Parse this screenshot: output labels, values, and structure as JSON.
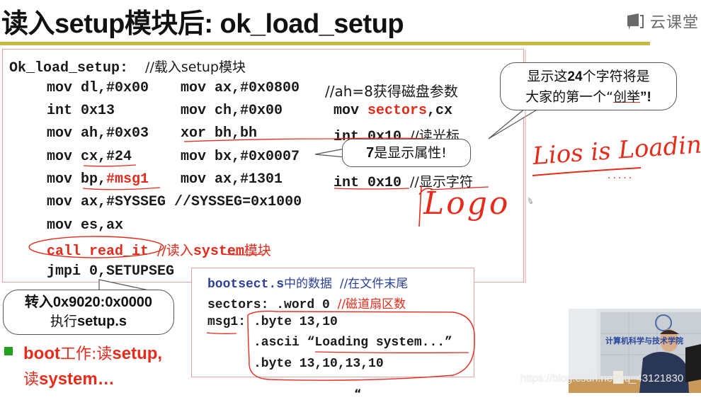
{
  "slide": {
    "title": "读入setup模块后: ok_load_setup",
    "logo_text": "云课堂",
    "logo_icon": "book-chat-icon"
  },
  "code": {
    "label_line": {
      "label": "Ok_load_setup:",
      "comment": "//载入setup模块"
    },
    "rows": [
      {
        "c1": "mov dl,#0x00",
        "c2": "mov ax,#0x0800",
        "c3_comment": "//ah=8获得磁盘参数"
      },
      {
        "c1": "int 0x13",
        "c2": "mov ch,#0x00",
        "c3_prefix": "mov ",
        "c3_red": "sectors",
        "c3_suffix": ",cx"
      },
      {
        "c1": "mov ah,#0x03",
        "c2": "xor bh,bh",
        "c3": "int 0x10",
        "c3_comment": "//读光标"
      },
      {
        "c1": "mov cx,#24",
        "c2": "mov bx,#0x0007"
      },
      {
        "c1_prefix": "mov bp,",
        "c1_red": "#msg1",
        "c2": "mov ax,#1301",
        "c3": "int 0x10",
        "c3_comment": "//显示字符"
      },
      {
        "c1": "mov ax,#SYSSEG",
        "c1_comment": "//SYSSEG=0x1000"
      },
      {
        "c1": "mov es,ax"
      },
      {
        "c1_red": "call read_it",
        "c1_comment_prefix": "//读入",
        "c1_comment_em": "system",
        "c1_comment_suffix": "模块"
      },
      {
        "c1": "jmpi 0,SETUPSEG"
      }
    ]
  },
  "callouts": {
    "chars": {
      "line1_a": "显示这",
      "line1_b": "24",
      "line1_c": "个字符将是",
      "line2_a": "大家的第一个“",
      "line2_b": "创举",
      "line2_c": "”!"
    },
    "attr": {
      "text_a": "7",
      "text_b": "是显示属性!"
    },
    "jump": {
      "line1": "转入0x9020:0x0000",
      "line2_a": "执行",
      "line2_b": "setup.s"
    }
  },
  "data_box": {
    "header_code": "bootsect.s",
    "header_cn": "中的数据",
    "header_comment": "//在文件末尾",
    "sectors_line": "sectors: .word 0",
    "sectors_comment": "//磁道扇区数",
    "msg_label": "msg1:",
    "msg_lines": [
      ".byte 13,10",
      ".ascii “Loading system...”",
      ".byte 13,10,13,10"
    ]
  },
  "bullet": {
    "line1_a": "boot",
    "line1_b": "工作:读",
    "line1_c": "setup,",
    "line2_a": "读",
    "line2_b": "system…"
  },
  "handwriting": {
    "boot_message": "Lios is Loading",
    "dots": ".....",
    "logo_word": "Logo"
  },
  "video": {
    "banner": "计算机科学与技术学院",
    "watermark": "https://blog.csdn.net/qq_43121830"
  },
  "colors": {
    "accent_bar": "#c4bb3e",
    "code_red": "#e82a1a",
    "code_blue": "#2c3f9a",
    "bullet_green": "#22a022",
    "box_border": "#e6a0a0"
  }
}
